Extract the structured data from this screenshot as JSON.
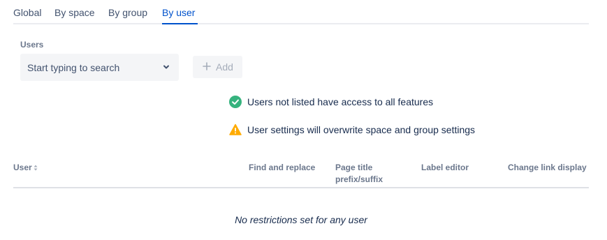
{
  "tabs": [
    {
      "label": "Global",
      "active": false
    },
    {
      "label": "By space",
      "active": false
    },
    {
      "label": "By group",
      "active": false
    },
    {
      "label": "By user",
      "active": true
    }
  ],
  "users_field": {
    "label": "Users",
    "placeholder": "Start typing to search",
    "icon": "chevron-down-icon"
  },
  "add_button": {
    "label": "Add",
    "icon": "plus-icon",
    "disabled": true
  },
  "notes": [
    {
      "icon": "check-circle-icon",
      "color": "#36b37e",
      "text": "Users not listed have access to all features"
    },
    {
      "icon": "warning-icon",
      "color": "#ffab00",
      "text": "User settings will overwrite space and group settings"
    }
  ],
  "table": {
    "columns": [
      "User",
      "Find and replace",
      "Page title prefix/suffix",
      "Label editor",
      "Change link display"
    ],
    "empty_message": "No restrictions set for any user"
  },
  "colors": {
    "accent": "#0052cc",
    "text": "#172b4d",
    "muted": "#6b778c"
  }
}
